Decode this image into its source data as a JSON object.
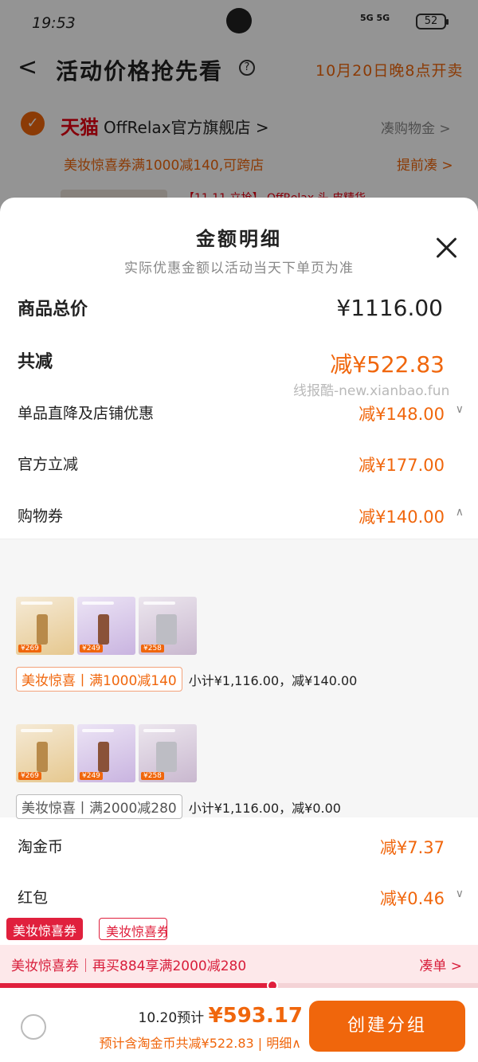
{
  "status_bar": {
    "time": "19:53",
    "signal": "5G 5G",
    "battery": "52"
  },
  "nav": {
    "back": "<",
    "title": "活动价格抢先看",
    "help": "?",
    "date": "10月20日晚8点开卖"
  },
  "store": {
    "check": "✓",
    "tmall": "天猫",
    "name": "OffRelax官方旗舰店 >",
    "fill": "凑购物金 >",
    "promo": "美妆惊喜券满1000减140,可跨店",
    "promo_link": "提前凑 >",
    "peek_text": "【11.11 立抢】 OffRelax 头 皮精华..."
  },
  "sheet": {
    "title": "金额明细",
    "subtitle": "实际优惠金额以活动当天下单页为准",
    "watermark": "线报酷-new.xianbao.fun",
    "rows": {
      "total": {
        "label": "商品总价",
        "value": "¥1116.00"
      },
      "reduce_all": {
        "label": "共减",
        "value": "减¥522.83"
      },
      "item_discount": {
        "label": "单品直降及店铺优惠",
        "value": "减¥148.00",
        "arrow": "∨"
      },
      "official": {
        "label": "官方立减",
        "value": "减¥177.00"
      },
      "coupon": {
        "label": "购物券",
        "value": "减¥140.00",
        "arrow": "∧"
      },
      "taojinbi": {
        "label": "淘金币",
        "value": "减¥7.37"
      },
      "hongbao": {
        "label": "红包",
        "value": "减¥0.46",
        "arrow": "∨"
      }
    },
    "coupon_groups": [
      {
        "thumb_tags": [
          "¥269",
          "¥249",
          "¥258"
        ],
        "pill": "美妆惊喜丨满1000减140",
        "summary": "小计¥1,116.00，减¥140.00"
      },
      {
        "thumb_tags": [
          "¥269",
          "¥249",
          "¥258"
        ],
        "pill": "美妆惊喜丨满2000减280",
        "summary": "小计¥1,116.00，减¥0.00"
      }
    ]
  },
  "floating_tags": {
    "solid": "美妆惊喜券",
    "outline": "美妆惊喜券"
  },
  "promo_strip": {
    "text": "美妆惊喜券｜再买884享满2000减280",
    "link": "凑单 >",
    "progress": 0.57
  },
  "footer": {
    "pre_label": "10.20预计",
    "pre_amount": "¥593.17",
    "sub": "预计含淘金币共减¥522.83 | 明细∧",
    "button": "创建分组"
  },
  "colors": {
    "accent": "#f0660c",
    "red": "#e0203d",
    "tmall": "#e60012"
  }
}
